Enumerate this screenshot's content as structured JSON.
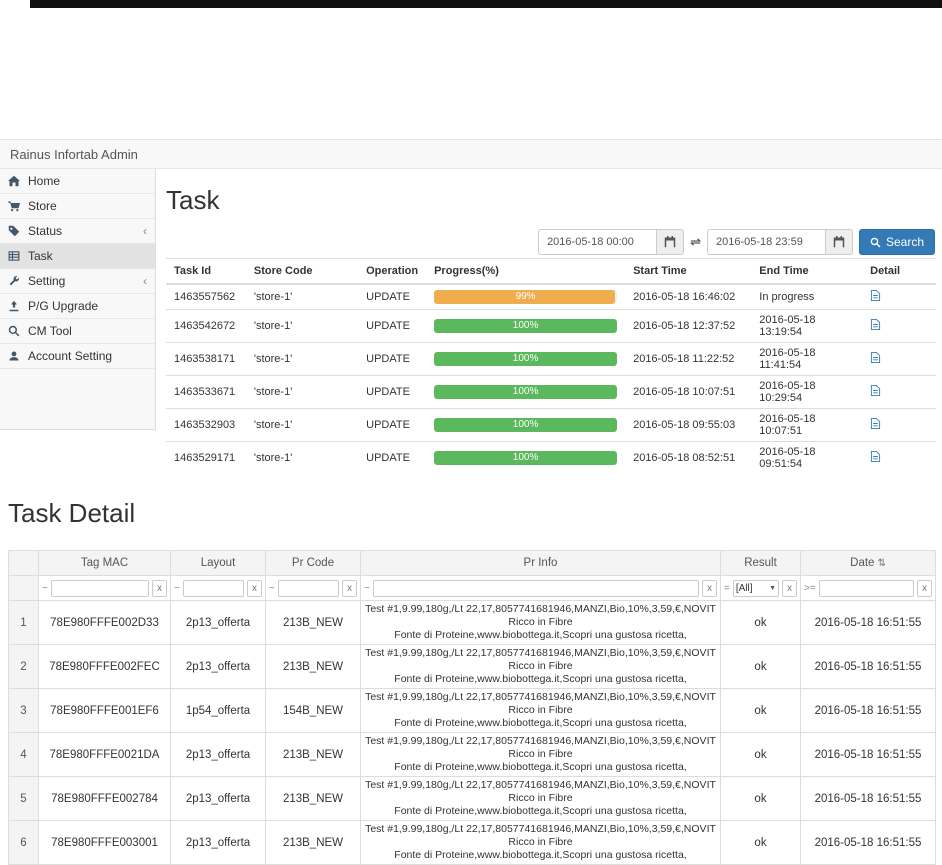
{
  "icons": {
    "swap": "⇌",
    "sort": "⇅",
    "chevron_down": "▼",
    "chevron_left": "‹"
  },
  "colors": {
    "primary": "#337ab7",
    "progress_warning": "#f0ad4e",
    "progress_success": "#5cb85c"
  },
  "navbar": {
    "brand": "Rainus Infortab Admin"
  },
  "sidebar": {
    "items": [
      {
        "label": "Home"
      },
      {
        "label": "Store"
      },
      {
        "label": "Status",
        "chevron": "‹"
      },
      {
        "label": "Task"
      },
      {
        "label": "Setting",
        "chevron": "‹"
      },
      {
        "label": "P/G Upgrade"
      },
      {
        "label": "CM Tool"
      },
      {
        "label": "Account Setting"
      }
    ]
  },
  "task": {
    "title": "Task",
    "date_from": "2016-05-18 00:00",
    "date_to": "2016-05-18 23:59",
    "search_label": "Search",
    "headers": [
      "Task Id",
      "Store Code",
      "Operation",
      "Progress(%)",
      "Start Time",
      "End Time",
      "Detail"
    ],
    "rows": [
      {
        "task_id": "1463557562",
        "store_code": "'store-1'",
        "operation": "UPDATE",
        "progress_pct": 99,
        "progress_label": "99%",
        "progress_color": "#f0ad4e",
        "start_time": "2016-05-18 16:46:02",
        "end_time": "In progress"
      },
      {
        "task_id": "1463542672",
        "store_code": "'store-1'",
        "operation": "UPDATE",
        "progress_pct": 100,
        "progress_label": "100%",
        "progress_color": "#5cb85c",
        "start_time": "2016-05-18 12:37:52",
        "end_time": "2016-05-18 13:19:54"
      },
      {
        "task_id": "1463538171",
        "store_code": "'store-1'",
        "operation": "UPDATE",
        "progress_pct": 100,
        "progress_label": "100%",
        "progress_color": "#5cb85c",
        "start_time": "2016-05-18 11:22:52",
        "end_time": "2016-05-18 11:41:54"
      },
      {
        "task_id": "1463533671",
        "store_code": "'store-1'",
        "operation": "UPDATE",
        "progress_pct": 100,
        "progress_label": "100%",
        "progress_color": "#5cb85c",
        "start_time": "2016-05-18 10:07:51",
        "end_time": "2016-05-18 10:29:54"
      },
      {
        "task_id": "1463532903",
        "store_code": "'store-1'",
        "operation": "UPDATE",
        "progress_pct": 100,
        "progress_label": "100%",
        "progress_color": "#5cb85c",
        "start_time": "2016-05-18 09:55:03",
        "end_time": "2016-05-18 10:07:51"
      },
      {
        "task_id": "1463529171",
        "store_code": "'store-1'",
        "operation": "UPDATE",
        "progress_pct": 100,
        "progress_label": "100%",
        "progress_color": "#5cb85c",
        "start_time": "2016-05-18 08:52:51",
        "end_time": "2016-05-18 09:51:54"
      }
    ]
  },
  "detail": {
    "title": "Task Detail",
    "headers": {
      "index": "",
      "tag_mac": "Tag MAC",
      "layout": "Layout",
      "pr_code": "Pr Code",
      "pr_info": "Pr Info",
      "result": "Result",
      "date": "Date",
      "sort_icon": "⇅"
    },
    "filters": {
      "tag_mac": {
        "op": "~",
        "clear": "x"
      },
      "layout": {
        "op": "~",
        "clear": "x"
      },
      "pr_code": {
        "op": "~",
        "clear": "x"
      },
      "pr_info": {
        "op": "~",
        "clear": "x"
      },
      "result": {
        "op": "=",
        "value": "[All]",
        "clear": "x"
      },
      "date": {
        "op": ">=",
        "clear": "x"
      }
    },
    "rows": [
      {
        "index": "1",
        "tag_mac": "78E980FFFE002D33",
        "layout": "2p13_offerta",
        "pr_code": "213B_NEW",
        "pr_info_1": "Test #1,9.99,180g,/Lt 22,17,8057741681946,MANZI,Bio,10%,3,59,€,NOVIT",
        "pr_info_2": "Ricco in Fibre",
        "pr_info_3": "Fonte di Proteine,www.biobottega.it,Scopri una gustosa ricetta,",
        "result": "ok",
        "date": "2016-05-18 16:51:55"
      },
      {
        "index": "2",
        "tag_mac": "78E980FFFE002FEC",
        "layout": "2p13_offerta",
        "pr_code": "213B_NEW",
        "pr_info_1": "Test #1,9.99,180g,/Lt 22,17,8057741681946,MANZI,Bio,10%,3,59,€,NOVIT",
        "pr_info_2": "Ricco in Fibre",
        "pr_info_3": "Fonte di Proteine,www.biobottega.it,Scopri una gustosa ricetta,",
        "result": "ok",
        "date": "2016-05-18 16:51:55"
      },
      {
        "index": "3",
        "tag_mac": "78E980FFFE001EF6",
        "layout": "1p54_offerta",
        "pr_code": "154B_NEW",
        "pr_info_1": "Test #1,9.99,180g,/Lt 22,17,8057741681946,MANZI,Bio,10%,3,59,€,NOVIT",
        "pr_info_2": "Ricco in Fibre",
        "pr_info_3": "Fonte di Proteine,www.biobottega.it,Scopri una gustosa ricetta,",
        "result": "ok",
        "date": "2016-05-18 16:51:55"
      },
      {
        "index": "4",
        "tag_mac": "78E980FFFE0021DA",
        "layout": "2p13_offerta",
        "pr_code": "213B_NEW",
        "pr_info_1": "Test #1,9.99,180g,/Lt 22,17,8057741681946,MANZI,Bio,10%,3,59,€,NOVIT",
        "pr_info_2": "Ricco in Fibre",
        "pr_info_3": "Fonte di Proteine,www.biobottega.it,Scopri una gustosa ricetta,",
        "result": "ok",
        "date": "2016-05-18 16:51:55"
      },
      {
        "index": "5",
        "tag_mac": "78E980FFFE002784",
        "layout": "2p13_offerta",
        "pr_code": "213B_NEW",
        "pr_info_1": "Test #1,9.99,180g,/Lt 22,17,8057741681946,MANZI,Bio,10%,3,59,€,NOVIT",
        "pr_info_2": "Ricco in Fibre",
        "pr_info_3": "Fonte di Proteine,www.biobottega.it,Scopri una gustosa ricetta,",
        "result": "ok",
        "date": "2016-05-18 16:51:55"
      },
      {
        "index": "6",
        "tag_mac": "78E980FFFE003001",
        "layout": "2p13_offerta",
        "pr_code": "213B_NEW",
        "pr_info_1": "Test #1,9.99,180g,/Lt 22,17,8057741681946,MANZI,Bio,10%,3,59,€,NOVIT",
        "pr_info_2": "Ricco in Fibre",
        "pr_info_3": "Fonte di Proteine,www.biobottega.it,Scopri una gustosa ricetta,",
        "result": "ok",
        "date": "2016-05-18 16:51:55"
      }
    ]
  }
}
